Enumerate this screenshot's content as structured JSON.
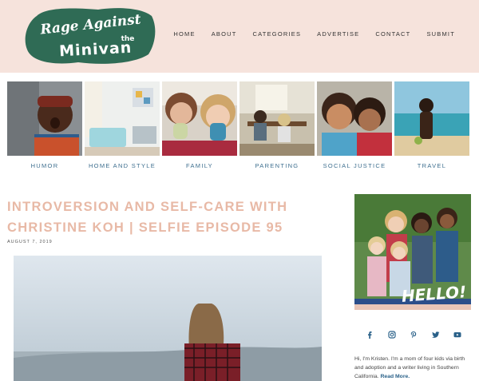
{
  "logo": {
    "line1": "Rage Against",
    "line2": "the",
    "line3": "Minivan"
  },
  "nav": [
    "HOME",
    "ABOUT",
    "CATEGORIES",
    "ADVERTISE",
    "CONTACT",
    "SUBMIT"
  ],
  "categories": [
    {
      "label": "HUMOR"
    },
    {
      "label": "HOME AND STYLE"
    },
    {
      "label": "FAMILY"
    },
    {
      "label": "PARENTING"
    },
    {
      "label": "SOCIAL JUSTICE"
    },
    {
      "label": "TRAVEL"
    }
  ],
  "post": {
    "title_line1": "INTROVERSION AND SELF-CARE WITH",
    "title_line2": "CHRISTINE KOH | SELFIE EPISODE 95",
    "date": "AUGUST 7, 2019"
  },
  "sidebar": {
    "hello": "HELLO!",
    "social_icons": [
      "facebook-icon",
      "instagram-icon",
      "pinterest-icon",
      "twitter-icon",
      "youtube-icon"
    ],
    "bio_text": "Hi, I'm Kristen. I'm a mom of four kids via birth and adoption and a writer living in Southern California.",
    "read_more": "Read More."
  },
  "colors": {
    "header_bg": "#f6e3dc",
    "logo_green": "#2f6b55",
    "title_pink": "#e8b9a6",
    "link_blue": "#3e6f8f",
    "social_blue": "#2a6189"
  }
}
